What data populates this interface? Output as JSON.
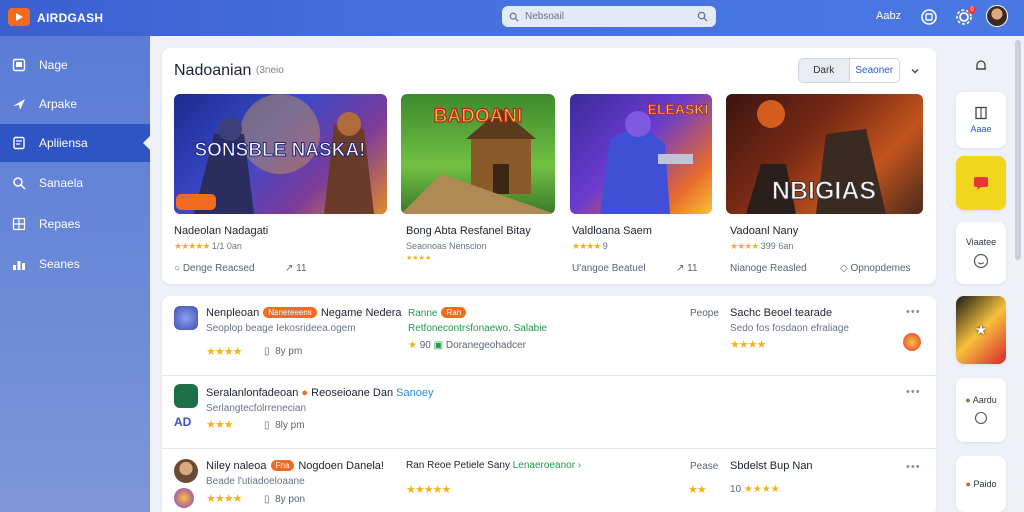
{
  "app": {
    "brand": "AIRDGASH"
  },
  "search": {
    "placeholder": "Nebsoail"
  },
  "topbar": {
    "link": "Aabz",
    "notif_count": "0"
  },
  "sidebar": {
    "items": [
      {
        "label": "Nage",
        "icon": "home-icon"
      },
      {
        "label": "Arpake",
        "icon": "plane-icon"
      },
      {
        "label": "Apliiensa",
        "icon": "apps-icon",
        "active": true
      },
      {
        "label": "Sanaela",
        "icon": "search-icon"
      },
      {
        "label": "Repaes",
        "icon": "grid-icon"
      },
      {
        "label": "Seanes",
        "icon": "sliders-icon"
      }
    ]
  },
  "featured": {
    "title": "Nadoanian",
    "subtitle": "(3neio",
    "toggle": [
      "Dark",
      "Seaoner"
    ],
    "cards": [
      {
        "title_art": "SONSBLE NASKA!",
        "name": "Nadeolan Nadagati",
        "rating_text": "1/1 0an",
        "foot_left": "Denge Reacsed",
        "share": "11",
        "label": "..."
      },
      {
        "title_art": "BADOANI",
        "name": "Bong Abta Resfanel Bitay",
        "meta": "Seaonoas Nenscion",
        "foot_left": "",
        "share": ""
      },
      {
        "title_art": "ELEASKI",
        "name": "Valdloana Saem",
        "rating_text": "9",
        "foot_left": "U'angoe Beatuel",
        "share": "11"
      },
      {
        "title_art": "NBIGIAS",
        "name": "Vadoanl Nany",
        "rating_text": "399 6an",
        "foot_left": "Nianoge Reasled",
        "foot_right": "Opnopdemes"
      }
    ]
  },
  "apps": [
    {
      "name": "Nenpleoan",
      "tag": "Nanereeens",
      "name2": "Negame Nedera",
      "sub": "Seoplop beage Iekosrideea.ogem",
      "stars": "★★★★",
      "meta": "8y pm",
      "mid_title": "Ranne",
      "mid_tag": "Ran",
      "mid_sub": "Retfonecontrsfonaewo. Salabie",
      "mid_meta": "Doranegeohadcer",
      "mid_rating": "90",
      "right_label": "Peope",
      "right_title": "Sachc Beoel tearade",
      "right_sub": "Sedo fos fosdaon efraliage",
      "right_stars": "★★★★"
    },
    {
      "name": "Seralanlonfadeoan",
      "name2": "Reoseioane Dan",
      "link": "Sanoey",
      "sub": "Serlangtecfolrrenecian",
      "stars": "★★★",
      "meta": "8ly pm",
      "icon_text": "AD"
    },
    {
      "name": "Niley naleoa",
      "tag": "Fna",
      "name2": "Nogdoen Danela!",
      "mid_title": "Ran Reoe Petiele Sany",
      "mid_link": "Lenaeroeanor",
      "sub": "Beade l'utiadoeloaane",
      "stars": "★★★★",
      "meta": "8y pon",
      "mid_stars": "★★★★★",
      "right_label": "Pease",
      "right_title": "Sbdelst Bup Nan",
      "right_rating": "10",
      "right_stars": "★★★★"
    }
  ],
  "rail": {
    "items": [
      {
        "label": "",
        "icon": "bell-icon"
      },
      {
        "label": "Aaae",
        "icon": "book-icon"
      },
      {
        "label": "",
        "icon": "chat-icon"
      },
      {
        "label": "Viaatee",
        "icon": "smile-icon"
      },
      {
        "label": "",
        "icon": "game-thumb"
      },
      {
        "label": "Aardu",
        "icon": "avatar-icon"
      },
      {
        "label": "Paido",
        "icon": "avatar-icon"
      }
    ]
  },
  "colors": {
    "accent": "#3a5fd0",
    "sidebar_active": "#2f55c4",
    "brand_orange": "#f26b21",
    "star": "#f6b21b"
  }
}
